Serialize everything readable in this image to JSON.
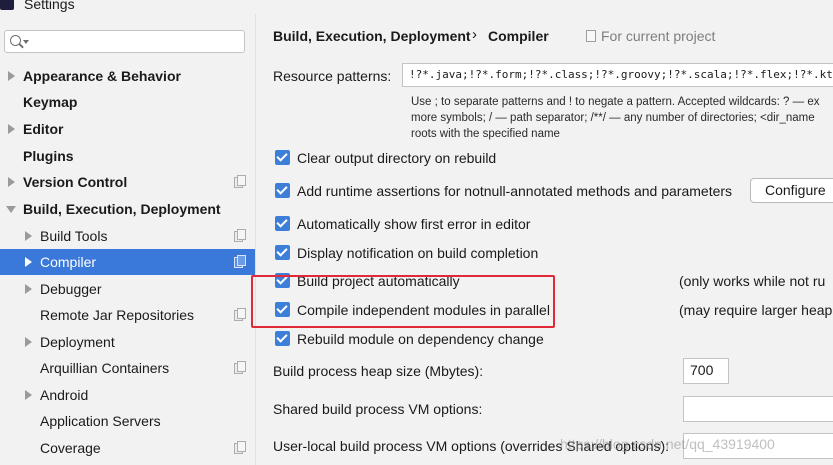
{
  "window": {
    "title": "Settings"
  },
  "sidebar": {
    "search_placeholder": "",
    "items": [
      {
        "label": "Appearance & Behavior"
      },
      {
        "label": "Keymap"
      },
      {
        "label": "Editor"
      },
      {
        "label": "Plugins"
      },
      {
        "label": "Version Control"
      },
      {
        "label": "Build, Execution, Deployment"
      },
      {
        "label": "Build Tools"
      },
      {
        "label": "Compiler"
      },
      {
        "label": "Debugger"
      },
      {
        "label": "Remote Jar Repositories"
      },
      {
        "label": "Deployment"
      },
      {
        "label": "Arquillian Containers"
      },
      {
        "label": "Android"
      },
      {
        "label": "Application Servers"
      },
      {
        "label": "Coverage"
      }
    ]
  },
  "main": {
    "breadcrumb": [
      "Build, Execution, Deployment",
      "Compiler"
    ],
    "breadcrumb_separator": "›",
    "for_current_project": "For current project",
    "resource_patterns": {
      "label": "Resource patterns:",
      "value": "!?*.java;!?*.form;!?*.class;!?*.groovy;!?*.scala;!?*.flex;!?*.kt;!?*.clj"
    },
    "help": {
      "line1": "Use ; to separate patterns and ! to negate a pattern. Accepted wildcards: ? — ex",
      "line2": "more symbols; / — path separator; /**/ — any number of directories; <dir_name",
      "line3": "roots with the specified name"
    },
    "options": [
      {
        "label": "Clear output directory on rebuild",
        "checked": true
      },
      {
        "label": "Add runtime assertions for notnull-annotated methods and parameters",
        "checked": true
      },
      {
        "label": "Automatically show first error in editor",
        "checked": true
      },
      {
        "label": "Display notification on build completion",
        "checked": true
      },
      {
        "label": "Build project automatically",
        "checked": true
      },
      {
        "label": "Compile independent modules in parallel",
        "checked": true
      },
      {
        "label": "Rebuild module on dependency change",
        "checked": true
      }
    ],
    "configure_button": "Configure",
    "build_auto_note": "(only works while not ru",
    "parallel_note": "(may require larger heap",
    "heap": {
      "label": "Build process heap size (Mbytes):",
      "value": "700"
    },
    "shared_vm": {
      "label": "Shared build process VM options:",
      "value": ""
    },
    "user_vm": {
      "label": "User-local build process VM options (overrides Shared options):",
      "value": ""
    }
  },
  "watermark": "https://blog.csdn.net/qq_43919400",
  "colors": {
    "accent": "#3a78d9",
    "checkbox": "#3d7fd8",
    "highlight": "#e02a3a"
  }
}
